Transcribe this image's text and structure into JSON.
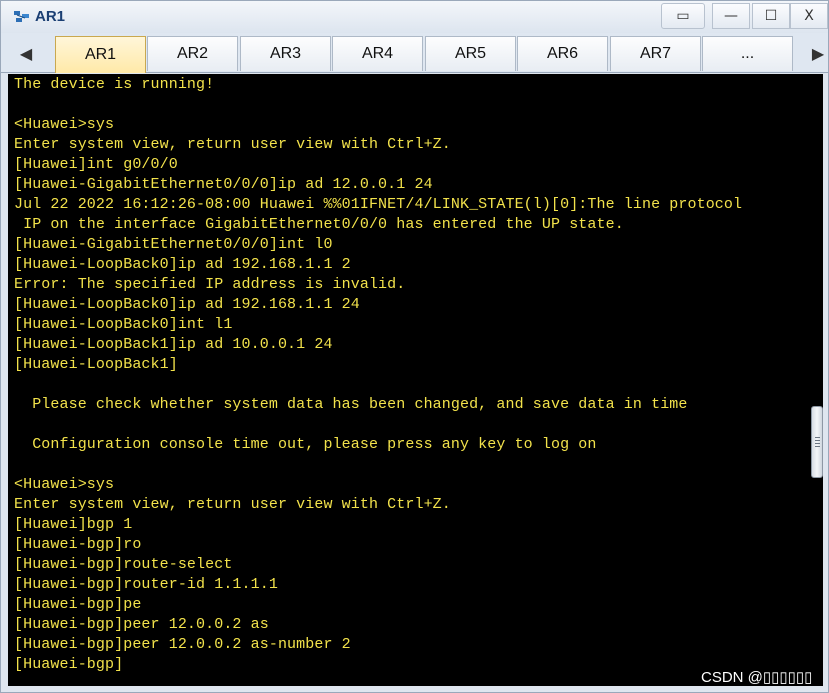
{
  "window": {
    "title": "AR1",
    "controls": {
      "restore_alt": "▭",
      "minimize": "—",
      "maximize": "☐",
      "close": "X"
    }
  },
  "tabs": {
    "scroll_left": "◀",
    "scroll_right": "▶",
    "items": [
      {
        "label": "AR1"
      },
      {
        "label": "AR2"
      },
      {
        "label": "AR3"
      },
      {
        "label": "AR4"
      },
      {
        "label": "AR5"
      },
      {
        "label": "AR6"
      },
      {
        "label": "AR7"
      },
      {
        "label": "..."
      }
    ],
    "active_index": 0
  },
  "terminal": {
    "text_color": "#f2e24b",
    "lines": [
      "The device is running!",
      "",
      "<Huawei>sys",
      "Enter system view, return user view with Ctrl+Z.",
      "[Huawei]int g0/0/0",
      "[Huawei-GigabitEthernet0/0/0]ip ad 12.0.0.1 24",
      "Jul 22 2022 16:12:26-08:00 Huawei %%01IFNET/4/LINK_STATE(l)[0]:The line protocol",
      " IP on the interface GigabitEthernet0/0/0 has entered the UP state.",
      "[Huawei-GigabitEthernet0/0/0]int l0",
      "[Huawei-LoopBack0]ip ad 192.168.1.1 2",
      "Error: The specified IP address is invalid.",
      "[Huawei-LoopBack0]ip ad 192.168.1.1 24",
      "[Huawei-LoopBack0]int l1",
      "[Huawei-LoopBack1]ip ad 10.0.0.1 24",
      "[Huawei-LoopBack1]",
      "",
      "  Please check whether system data has been changed, and save data in time",
      "",
      "  Configuration console time out, please press any key to log on",
      "",
      "<Huawei>sys",
      "Enter system view, return user view with Ctrl+Z.",
      "[Huawei]bgp 1",
      "[Huawei-bgp]ro",
      "[Huawei-bgp]route-select",
      "[Huawei-bgp]router-id 1.1.1.1",
      "[Huawei-bgp]pe",
      "[Huawei-bgp]peer 12.0.0.2 as",
      "[Huawei-bgp]peer 12.0.0.2 as-number 2",
      "[Huawei-bgp]"
    ]
  },
  "watermark": "CSDN @▯▯▯▯▯▯"
}
